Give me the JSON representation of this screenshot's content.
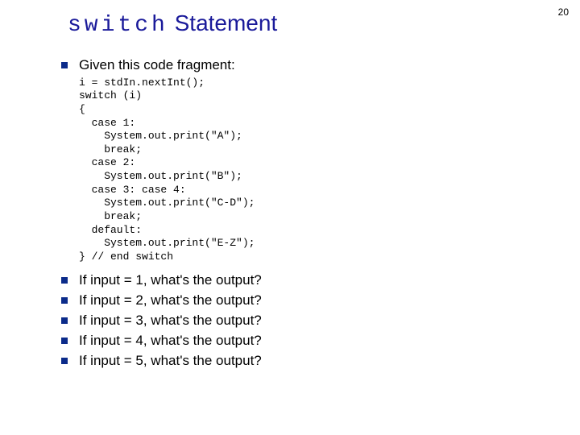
{
  "page_number": "20",
  "title": {
    "keyword": "switch",
    "rest": " Statement"
  },
  "intro": "Given this code fragment:",
  "code": "i = stdIn.nextInt();\nswitch (i)\n{\n  case 1:\n    System.out.print(\"A\");\n    break;\n  case 2:\n    System.out.print(\"B\");\n  case 3: case 4:\n    System.out.print(\"C-D\");\n    break;\n  default:\n    System.out.print(\"E-Z\");\n} // end switch",
  "questions": [
    "If input = 1, what's the output?",
    "If input = 2, what's the output?",
    "If input = 3, what's the output?",
    "If input = 4, what's the output?",
    "If input = 5, what's the output?"
  ]
}
